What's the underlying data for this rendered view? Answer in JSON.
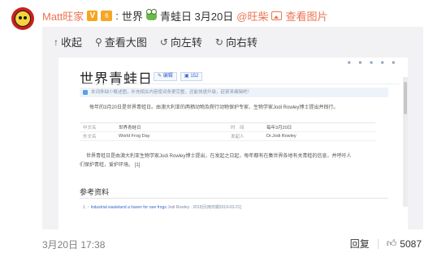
{
  "post": {
    "username": "Matt旺家",
    "verified_badge": "V",
    "level_badge": "6",
    "separator": ":",
    "text_prefix": "世界",
    "text_suffix": "青蛙日 3月20日",
    "mention": "@旺柴",
    "view_image": "查看图片"
  },
  "toolbar": {
    "collapse": "收起",
    "view_large": "查看大图",
    "rotate_left": "向左转",
    "rotate_right": "向右转"
  },
  "wiki": {
    "title": "世界青蛙日",
    "edit_btn": "✎ 编辑",
    "views_btn": "▣ 152",
    "notice": "本词条缺少概述图，补充相关内容使词条更完整，还能快速升级，赶紧来编辑吧！",
    "intro": "每年的3月20日是世界青蛙日。由澳大利亚的两栖动物及爬行动物保护专家、生物学家Jodi Rowley博士提出并践行。",
    "table": [
      {
        "k1": "中文名",
        "v1": "世界青蛙日",
        "k2": "时　间",
        "v2": "每年3月20日"
      },
      {
        "k1": "外文名",
        "v1": "World Frog Day",
        "k2": "发起人",
        "v2": "Dr.Jodi Rowley"
      }
    ],
    "body_line1": "世界青蛙日是由澳大利亚生物学家Jodi Rowley博士提出，在发起之日起，每年都有在集世界各地有关青蛙的信息，并呼吁人",
    "body_line2": "们保护青蛙，爱护环境。 [1]",
    "ref_title": "参考资料",
    "ref_index": "1. ↑",
    "ref_link": "Industrial wasteland a haven for rare frogs",
    "ref_meta": "Jodi Rowley . 2015[引用日期2019-03-21]"
  },
  "footer": {
    "time": "3月20日 17:38",
    "reply": "回复",
    "likes": "5087"
  }
}
